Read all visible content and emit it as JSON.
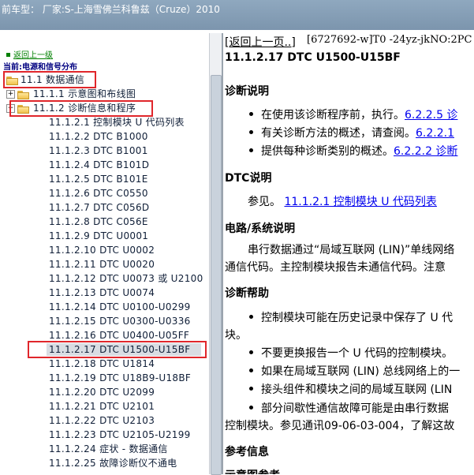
{
  "top_bar": {
    "title": "前车型： 厂家:S-上海雪佛兰科鲁兹（Cruze）2010"
  },
  "nav": {
    "back_link": "返回上一级",
    "current": "当前:电源和信号分布",
    "items": [
      "11.1 数据通信",
      "11.1.1 示意图和布线图",
      "11.1.2 诊断信息和程序",
      "11.1.2.1 控制模块 U 代码列表",
      "11.1.2.2 DTC B1000",
      "11.1.2.3 DTC B1001",
      "11.1.2.4 DTC B101D",
      "11.1.2.5 DTC B101E",
      "11.1.2.6 DTC C0550",
      "11.1.2.7 DTC C056D",
      "11.1.2.8 DTC C056E",
      "11.1.2.9 DTC U0001",
      "11.1.2.10 DTC U0002",
      "11.1.2.11 DTC U0020",
      "11.1.2.12 DTC U0073 或 U2100",
      "11.1.2.13 DTC U0074",
      "11.1.2.14 DTC U0100-U0299",
      "11.1.2.15 DTC U0300-U0336",
      "11.1.2.16 DTC U0400-U05FF",
      "11.1.2.17 DTC U1500-U15BF",
      "11.1.2.18 DTC U1814",
      "11.1.2.19 DTC U18B9-U18BF",
      "11.1.2.20 DTC U2099",
      "11.1.2.21 DTC U2101",
      "11.1.2.22 DTC U2103",
      "11.1.2.23 DTC U2105-U2199",
      "11.1.2.24 症状 - 数据通信",
      "11.1.2.25 故障诊断仪不通电"
    ]
  },
  "content": {
    "back_link": "[返回上一页..]",
    "doc_id": "[6727692-w]T0 -24yz-jkNO:2PC",
    "title": "11.1.2.17 DTC U1500-U15BF",
    "diag_heading": "诊断说明",
    "diag_b1": "在使用该诊断程序前，执行。",
    "diag_b1_link": "6.2.2.5 诊",
    "diag_b2": "有关诊断方法的概述，请查阅。",
    "diag_b2_link": "6.2.2.1",
    "diag_b3": "提供每种诊断类别的概述。",
    "diag_b3_link": "6.2.2.2 诊断",
    "dtc_heading": "DTC说明",
    "dtc_ref": "参见。",
    "dtc_ref_link": "11.1.2.1 控制模块 U 代码列表",
    "circuit_heading": "电路/系统说明",
    "circuit_line1": "串行数据通过“局域互联网 (LIN)”单线网络",
    "circuit_line2": "通信代码。主控制模块报告未通信代码。注意",
    "help_heading": "诊断帮助",
    "help_b1_line1": "控制模块可能在历史记录中保存了 U 代",
    "help_b1_line2": "块。",
    "help_b2": "不要更换报告一个 U 代码的控制模块。",
    "help_b3": "如果在局域互联网 (LIN) 总线网络上的一",
    "help_b4": "接头组件和模块之间的局域互联网 (LIN",
    "help_b5_line1": "部分间歇性通信故障可能是由串行数据",
    "help_b5_line2": "控制模块。参见通讯09-06-03-004，了解这故",
    "ref_heading": "参考信息",
    "schematic_heading": "示意图参考"
  }
}
